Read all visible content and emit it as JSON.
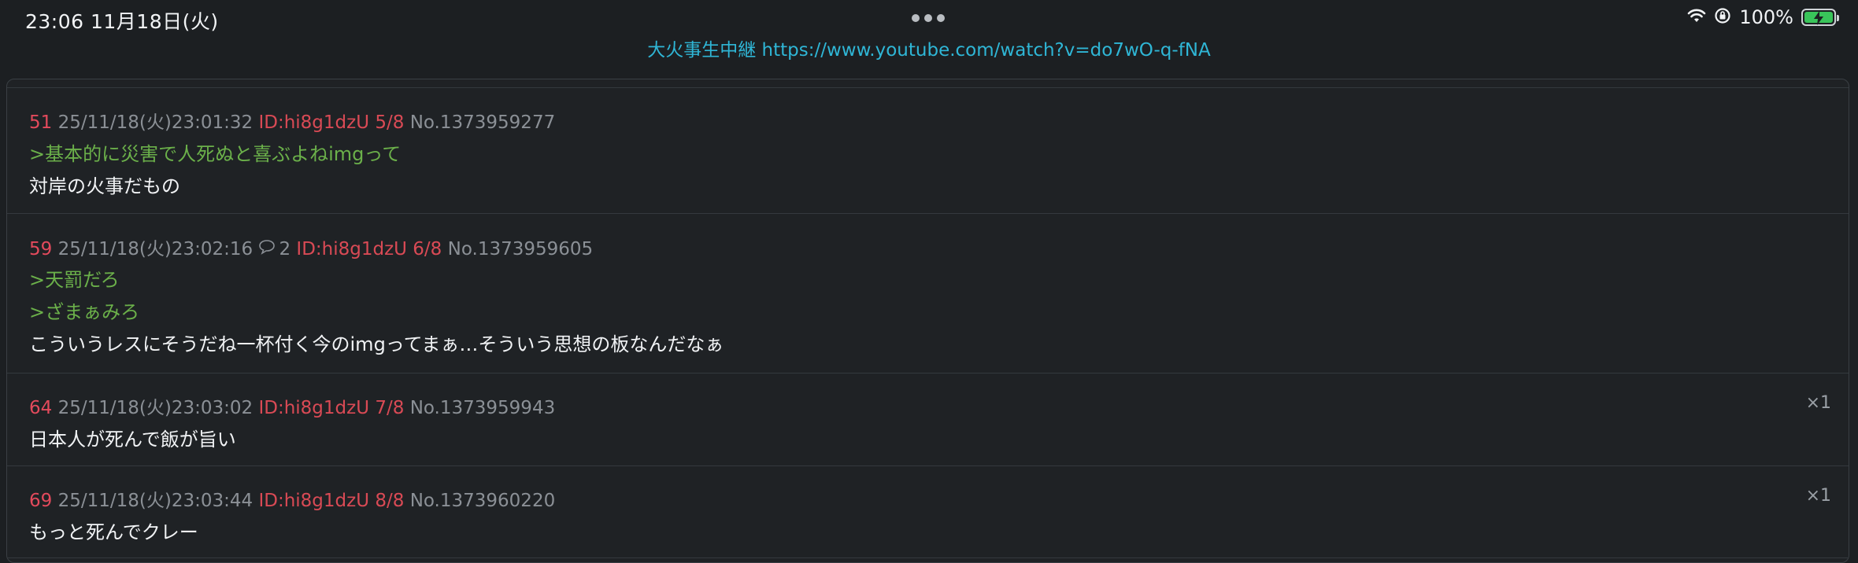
{
  "status_bar": {
    "time_date": "23:06   11月18日(火)",
    "battery_percent": "100%"
  },
  "thread_link": "大火事生中継 https://www.youtube.com/watch?v=do7wO-q-fNA",
  "posts": [
    {
      "number": "51",
      "datetime": "25/11/18(火)23:01:32",
      "id": "ID:hi8g1dzU 5/8",
      "no": "No.1373959277",
      "quotes": [
        ">基本的に災害で人死ぬと喜ぶよねimgって"
      ],
      "body": "対岸の火事だもの"
    },
    {
      "number": "59",
      "datetime": "25/11/18(火)23:02:16",
      "reply_count": "2",
      "id": "ID:hi8g1dzU 6/8",
      "no": "No.1373959605",
      "quotes": [
        ">天罰だろ",
        ">ざまぁみろ"
      ],
      "body": "こういうレスにそうだね一杯付く今のimgってまぁ…そういう思想の板なんだなぁ"
    },
    {
      "number": "64",
      "datetime": "25/11/18(火)23:03:02",
      "id": "ID:hi8g1dzU 7/8",
      "no": "No.1373959943",
      "body": "日本人が死んで飯が旨い",
      "soudane": "×1"
    },
    {
      "number": "69",
      "datetime": "25/11/18(火)23:03:44",
      "id": "ID:hi8g1dzU 8/8",
      "no": "No.1373960220",
      "body": "もっと死んでクレー",
      "soudane": "×1"
    }
  ]
}
